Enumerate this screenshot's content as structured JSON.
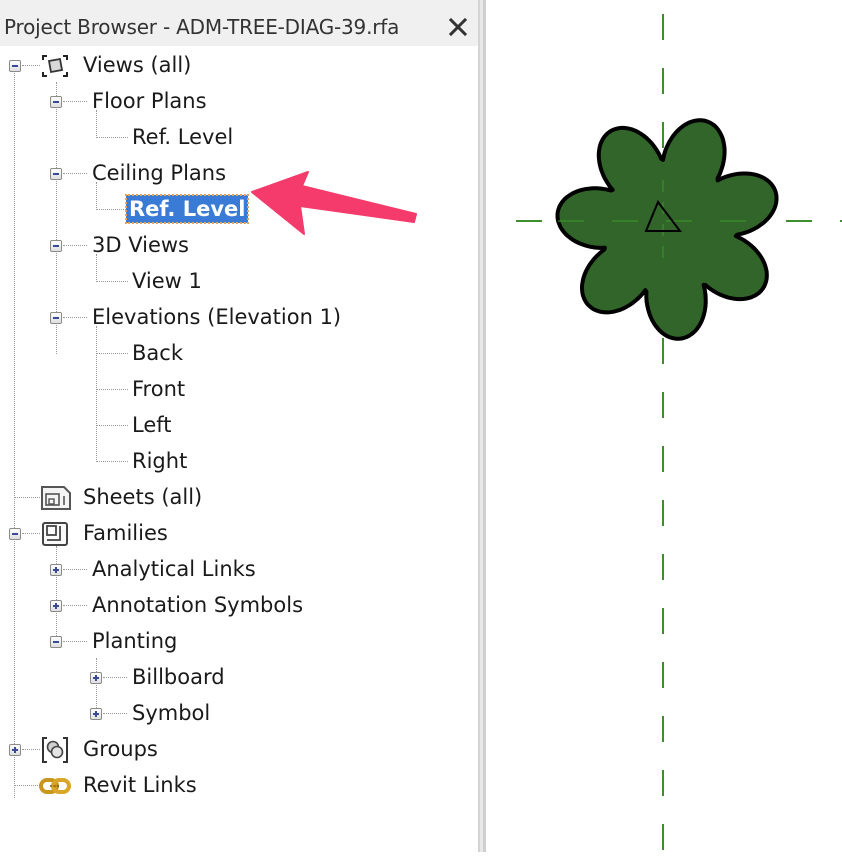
{
  "browser": {
    "title": "Project Browser - ADM-TREE-DIAG-39.rfa",
    "close_icon": "close-x-icon"
  },
  "tree": {
    "views_all": "Views (all)",
    "floor_plans": "Floor Plans",
    "floor_plans_ref_level": "Ref. Level",
    "ceiling_plans": "Ceiling Plans",
    "ceiling_plans_ref_level": "Ref. Level",
    "views_3d": "3D Views",
    "view_1": "View 1",
    "elevations": "Elevations (Elevation 1)",
    "back": "Back",
    "front": "Front",
    "left": "Left",
    "right": "Right",
    "sheets_all": "Sheets (all)",
    "families": "Families",
    "analytical_links": "Analytical Links",
    "annotation_symbols": "Annotation Symbols",
    "planting": "Planting",
    "billboard": "Billboard",
    "symbol": "Symbol",
    "groups": "Groups",
    "revit_links": "Revit Links",
    "selected_item": "Ceiling Plans > Ref. Level"
  },
  "canvas": {
    "element": "planting-tree-symbol",
    "tree_fill_color": "#32652a",
    "reference_line_color": "#3c8f2a"
  },
  "annotation": {
    "arrow_color": "#f43b6b",
    "points_to": "Ceiling Plans > Ref. Level"
  }
}
